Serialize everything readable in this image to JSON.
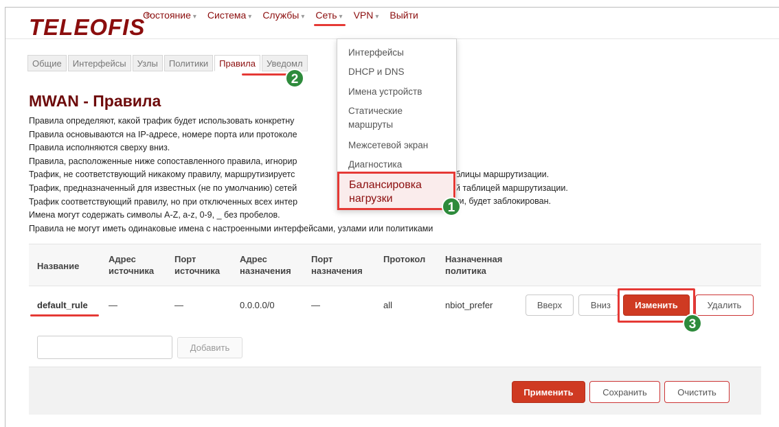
{
  "brand": {
    "logo": "TELEOFIS",
    "reg": "®"
  },
  "nav": [
    {
      "label": "Состояние",
      "caret": "▾"
    },
    {
      "label": "Система",
      "caret": "▾"
    },
    {
      "label": "Службы",
      "caret": "▾"
    },
    {
      "label": "Сеть",
      "caret": "▾"
    },
    {
      "label": "VPN",
      "caret": "▾"
    },
    {
      "label": "Выйти",
      "caret": ""
    }
  ],
  "tabs": [
    "Общие",
    "Интерфейсы",
    "Узлы",
    "Политики",
    "Правила",
    "Уведомл"
  ],
  "dropdown": [
    "Интерфейсы",
    "DHCP и DNS",
    "Имена устройств",
    "Статические",
    "маршруты",
    "Межсетевой экран",
    "Диагностика",
    "Балансировка",
    "нагрузки"
  ],
  "title": "MWAN - Правила",
  "description": [
    {
      "left": "Правила определяют, какой трафик будет использовать конкретну",
      "right": ""
    },
    {
      "left": "Правила основываются на IP-адресе, номере порта или протоколе",
      "right": ""
    },
    {
      "left": "Правила исполняются сверху вниз.",
      "right": ""
    },
    {
      "left": "Правила, расположенные ниже сопоставленного правила, игнорир",
      "right": ""
    },
    {
      "left": "Трафик, не соответствующий никакому правилу, маршрутизируетс",
      "right": "блицы маршрутизации."
    },
    {
      "left": "Трафик, предназначенный для известных (не по умолчанию) сетей",
      "right": "й таблицей маршрутизации."
    },
    {
      "left": "Трафик соответствующий правилу, но при отключенных всех интер",
      "right": "ки, будет заблокирован."
    },
    {
      "left": "Имена могут содержать символы A-Z, a-z, 0-9, _ без пробелов.",
      "right": ""
    },
    {
      "left": "Правила не могут иметь одинаковые имена с настроенными интерфейсами, узлами или политиками",
      "right": ""
    }
  ],
  "table": {
    "headers": [
      [
        "Название",
        ""
      ],
      [
        "Адрес",
        "источника"
      ],
      [
        "Порт",
        "источника"
      ],
      [
        "Адрес",
        "назначения"
      ],
      [
        "Порт",
        "назначения"
      ],
      [
        "Протокол",
        ""
      ],
      [
        "Назначенная",
        "политика"
      ]
    ],
    "row": [
      "default_rule",
      "—",
      "—",
      "0.0.0.0/0",
      "—",
      "all",
      "nbiot_prefer"
    ],
    "buttons": {
      "up": "Вверх",
      "down": "Вниз",
      "edit": "Изменить",
      "delete": "Удалить"
    }
  },
  "add": {
    "button": "Добавить",
    "value": ""
  },
  "footer": {
    "apply": "Применить",
    "save": "Сохранить",
    "clear": "Очистить"
  },
  "badges": [
    "1",
    "2",
    "3"
  ],
  "colors": {
    "brand": "#8b0d0d",
    "accent": "#cf3a22",
    "highlight": "#e53935",
    "badge": "#2e8b3c"
  }
}
